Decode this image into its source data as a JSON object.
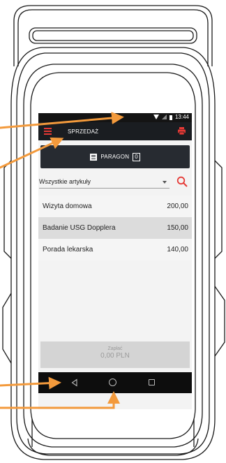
{
  "status_bar": {
    "time": "13:44"
  },
  "app_bar": {
    "title": "SPRZEDAŻ"
  },
  "receipt_button": {
    "label": "PARAGON",
    "count": "0"
  },
  "filter": {
    "selected": "Wszystkie artykuły"
  },
  "items": [
    {
      "name": "Wizyta domowa",
      "price": "200,00"
    },
    {
      "name": "Badanie USG Dopplera",
      "price": "150,00"
    },
    {
      "name": "Porada lekarska",
      "price": "140,00"
    }
  ],
  "pay_button": {
    "label": "Zapłać",
    "amount": "0,00 PLN"
  },
  "colors": {
    "accent": "#e53935",
    "arrow": "#f39a3c",
    "app_bar": "#1a1d21"
  }
}
